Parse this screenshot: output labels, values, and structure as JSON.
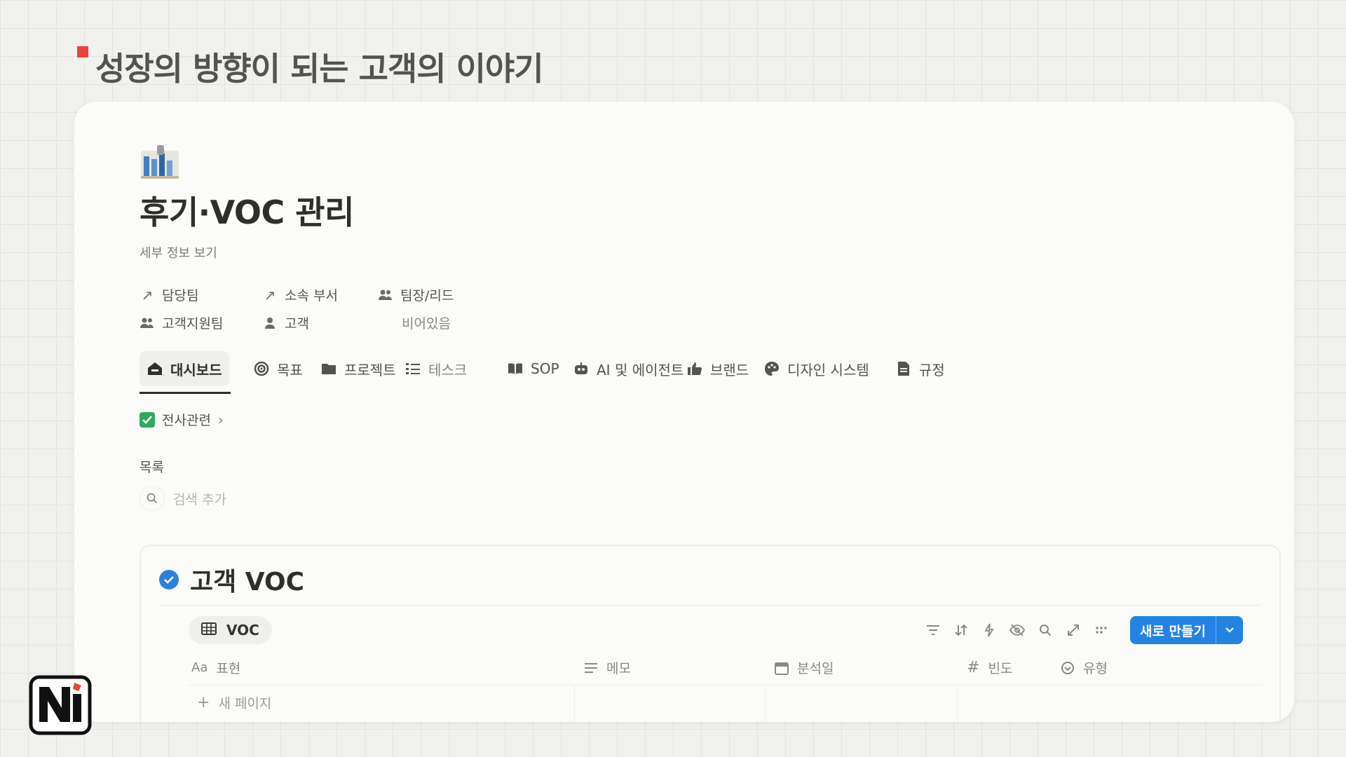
{
  "slide": {
    "title": "성장의 방향이 되는 고객의 이야기"
  },
  "page": {
    "title": "후기·VOC 관리",
    "subtitle": "세부 정보 보기",
    "properties": {
      "team_label": "담당팀",
      "team_value": "고객지원팀",
      "dept_label": "소속 부서",
      "dept_value": "고객",
      "lead_label": "팀장/리드",
      "lead_value": "비어있음"
    }
  },
  "tabs": [
    {
      "label": "대시보드",
      "icon": "home-icon",
      "active": true
    },
    {
      "label": "목표",
      "icon": "target-icon"
    },
    {
      "label": "프로젝트",
      "icon": "folder-icon"
    },
    {
      "label": "테스크",
      "icon": "checklist-icon"
    },
    {
      "label": "SOP",
      "icon": "book-icon"
    },
    {
      "label": "AI 및 에이전트",
      "icon": "robot-icon"
    },
    {
      "label": "브랜드",
      "icon": "thumbs-up-icon"
    },
    {
      "label": "디자인 시스템",
      "icon": "palette-icon"
    },
    {
      "label": "규정",
      "icon": "document-icon"
    }
  ],
  "breadcrumb": {
    "label": "전사관련"
  },
  "list": {
    "label": "목록",
    "search_placeholder": "검색 추가"
  },
  "database": {
    "title": "고객 VOC",
    "view_tab": "VOC",
    "new_button": "새로 만들기",
    "columns": [
      {
        "icon": "Aa",
        "label": "표현"
      },
      {
        "icon": "lines-icon",
        "label": "메모"
      },
      {
        "icon": "calendar-icon",
        "label": "분석일"
      },
      {
        "icon": "hash-icon",
        "label": "빈도"
      },
      {
        "icon": "select-icon",
        "label": "유형"
      }
    ],
    "new_page": "새 페이지"
  },
  "colors": {
    "accent": "#2383e2",
    "check_green": "#2eaa5f",
    "slide_marker": "#e6453a"
  }
}
